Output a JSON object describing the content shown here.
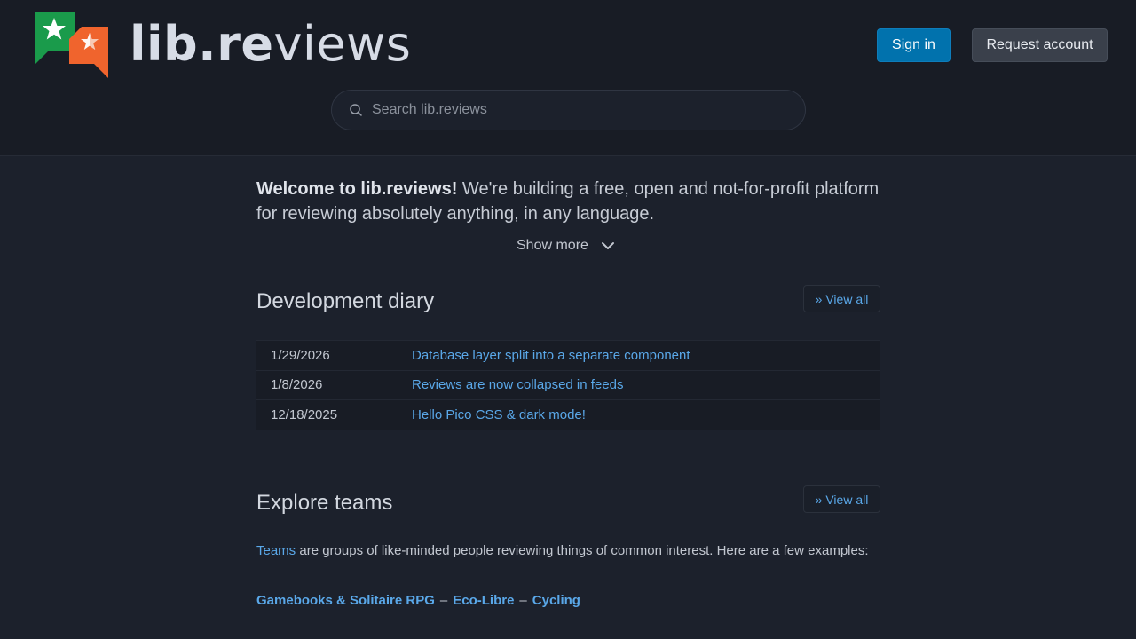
{
  "header": {
    "logo": {
      "bold_part": "lib.re",
      "light_part": "views"
    },
    "colors": {
      "logo_green": "#1a9b4b",
      "logo_orange": "#f0642d",
      "signin_bg": "#0172ad"
    },
    "signin_label": "Sign in",
    "request_label": "Request account",
    "search": {
      "placeholder": "Search lib.reviews",
      "value": ""
    }
  },
  "intro": {
    "strong": "Welcome to lib.reviews!",
    "text": " We're building a free, open and not-for-profit platform for reviewing absolutely anything, in any language."
  },
  "show_more_label": "Show more",
  "diary": {
    "title": "Development diary",
    "view_all": "» View all",
    "entries": [
      {
        "date": "1/29/2026",
        "title": "Database layer split into a separate component"
      },
      {
        "date": "1/8/2026",
        "title": "Reviews are now collapsed in feeds"
      },
      {
        "date": "12/18/2025",
        "title": "Hello Pico CSS & dark mode!"
      }
    ]
  },
  "teams": {
    "title": "Explore teams",
    "view_all": "» View all",
    "intro_link": "Teams",
    "intro_text": " are groups of like-minded people reviewing things of common interest. Here are a few examples:",
    "examples": [
      "Gamebooks & Solitaire RPG",
      "Eco-Libre",
      "Cycling"
    ],
    "separator": "–"
  }
}
